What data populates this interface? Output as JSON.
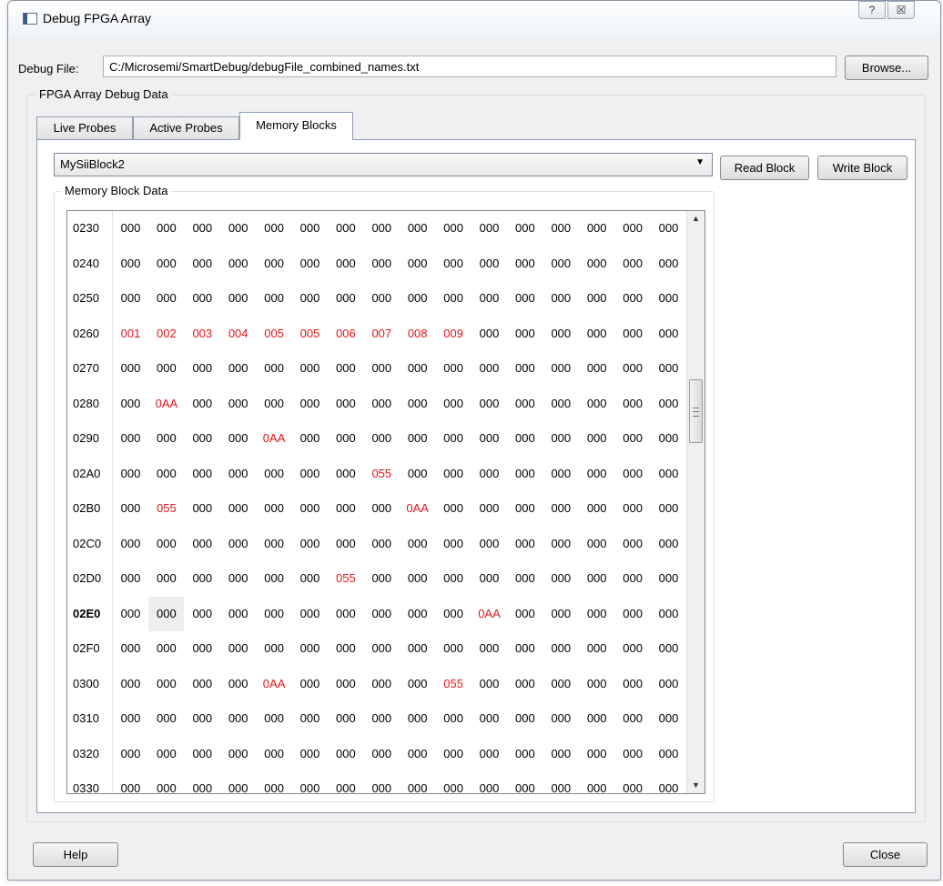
{
  "window": {
    "title": "Debug FPGA Array",
    "help_glyph": "?",
    "close_glyph": "☒"
  },
  "debug_file": {
    "label": "Debug File:",
    "value": "C:/Microsemi/SmartDebug/debugFile_combined_names.txt",
    "browse_label": "Browse..."
  },
  "group": {
    "title": "FPGA Array Debug Data"
  },
  "tabs": [
    {
      "label": "Live Probes",
      "active": false
    },
    {
      "label": "Active Probes",
      "active": false
    },
    {
      "label": "Memory Blocks",
      "active": true
    }
  ],
  "memory": {
    "selected_block": "MySiiBlock2",
    "read_label": "Read Block",
    "write_label": "Write Block",
    "group_title": "Memory Block Data",
    "highlight_color": "#e3151a",
    "rows": [
      {
        "addr": "0230",
        "bold": false,
        "cells": [
          "000",
          "000",
          "000",
          "000",
          "000",
          "000",
          "000",
          "000",
          "000",
          "000",
          "000",
          "000",
          "000",
          "000",
          "000",
          "000"
        ],
        "red": []
      },
      {
        "addr": "0240",
        "bold": false,
        "cells": [
          "000",
          "000",
          "000",
          "000",
          "000",
          "000",
          "000",
          "000",
          "000",
          "000",
          "000",
          "000",
          "000",
          "000",
          "000",
          "000"
        ],
        "red": []
      },
      {
        "addr": "0250",
        "bold": false,
        "cells": [
          "000",
          "000",
          "000",
          "000",
          "000",
          "000",
          "000",
          "000",
          "000",
          "000",
          "000",
          "000",
          "000",
          "000",
          "000",
          "000"
        ],
        "red": []
      },
      {
        "addr": "0260",
        "bold": false,
        "cells": [
          "001",
          "002",
          "003",
          "004",
          "005",
          "005",
          "006",
          "007",
          "008",
          "009",
          "000",
          "000",
          "000",
          "000",
          "000",
          "000"
        ],
        "red": [
          0,
          1,
          2,
          3,
          4,
          5,
          6,
          7,
          8,
          9
        ]
      },
      {
        "addr": "0270",
        "bold": false,
        "cells": [
          "000",
          "000",
          "000",
          "000",
          "000",
          "000",
          "000",
          "000",
          "000",
          "000",
          "000",
          "000",
          "000",
          "000",
          "000",
          "000"
        ],
        "red": []
      },
      {
        "addr": "0280",
        "bold": false,
        "cells": [
          "000",
          "0AA",
          "000",
          "000",
          "000",
          "000",
          "000",
          "000",
          "000",
          "000",
          "000",
          "000",
          "000",
          "000",
          "000",
          "000"
        ],
        "red": [
          1
        ]
      },
      {
        "addr": "0290",
        "bold": false,
        "cells": [
          "000",
          "000",
          "000",
          "000",
          "0AA",
          "000",
          "000",
          "000",
          "000",
          "000",
          "000",
          "000",
          "000",
          "000",
          "000",
          "000"
        ],
        "red": [
          4
        ]
      },
      {
        "addr": "02A0",
        "bold": false,
        "cells": [
          "000",
          "000",
          "000",
          "000",
          "000",
          "000",
          "000",
          "055",
          "000",
          "000",
          "000",
          "000",
          "000",
          "000",
          "000",
          "000"
        ],
        "red": [
          7
        ]
      },
      {
        "addr": "02B0",
        "bold": false,
        "cells": [
          "000",
          "055",
          "000",
          "000",
          "000",
          "000",
          "000",
          "000",
          "0AA",
          "000",
          "000",
          "000",
          "000",
          "000",
          "000",
          "000"
        ],
        "red": [
          1,
          8
        ]
      },
      {
        "addr": "02C0",
        "bold": false,
        "cells": [
          "000",
          "000",
          "000",
          "000",
          "000",
          "000",
          "000",
          "000",
          "000",
          "000",
          "000",
          "000",
          "000",
          "000",
          "000",
          "000"
        ],
        "red": []
      },
      {
        "addr": "02D0",
        "bold": false,
        "cells": [
          "000",
          "000",
          "000",
          "000",
          "000",
          "000",
          "055",
          "000",
          "000",
          "000",
          "000",
          "000",
          "000",
          "000",
          "000",
          "000"
        ],
        "red": [
          6
        ]
      },
      {
        "addr": "02E0",
        "bold": true,
        "cells": [
          "000",
          "000",
          "000",
          "000",
          "000",
          "000",
          "000",
          "000",
          "000",
          "000",
          "0AA",
          "000",
          "000",
          "000",
          "000",
          "000"
        ],
        "red": [
          10
        ],
        "selected": 1
      },
      {
        "addr": "02F0",
        "bold": false,
        "cells": [
          "000",
          "000",
          "000",
          "000",
          "000",
          "000",
          "000",
          "000",
          "000",
          "000",
          "000",
          "000",
          "000",
          "000",
          "000",
          "000"
        ],
        "red": []
      },
      {
        "addr": "0300",
        "bold": false,
        "cells": [
          "000",
          "000",
          "000",
          "000",
          "0AA",
          "000",
          "000",
          "000",
          "000",
          "055",
          "000",
          "000",
          "000",
          "000",
          "000",
          "000"
        ],
        "red": [
          4,
          9
        ]
      },
      {
        "addr": "0310",
        "bold": false,
        "cells": [
          "000",
          "000",
          "000",
          "000",
          "000",
          "000",
          "000",
          "000",
          "000",
          "000",
          "000",
          "000",
          "000",
          "000",
          "000",
          "000"
        ],
        "red": []
      },
      {
        "addr": "0320",
        "bold": false,
        "cells": [
          "000",
          "000",
          "000",
          "000",
          "000",
          "000",
          "000",
          "000",
          "000",
          "000",
          "000",
          "000",
          "000",
          "000",
          "000",
          "000"
        ],
        "red": []
      },
      {
        "addr": "0330",
        "bold": false,
        "cells": [
          "000",
          "000",
          "000",
          "000",
          "000",
          "000",
          "000",
          "000",
          "000",
          "000",
          "000",
          "000",
          "000",
          "000",
          "000",
          "000"
        ],
        "red": []
      }
    ]
  },
  "footer": {
    "help_label": "Help",
    "close_label": "Close"
  },
  "icons": {
    "app": "app-window-icon",
    "dropdown": "chevron-down-icon",
    "scroll_up": "arrow-up-icon",
    "scroll_down": "arrow-down-icon"
  }
}
